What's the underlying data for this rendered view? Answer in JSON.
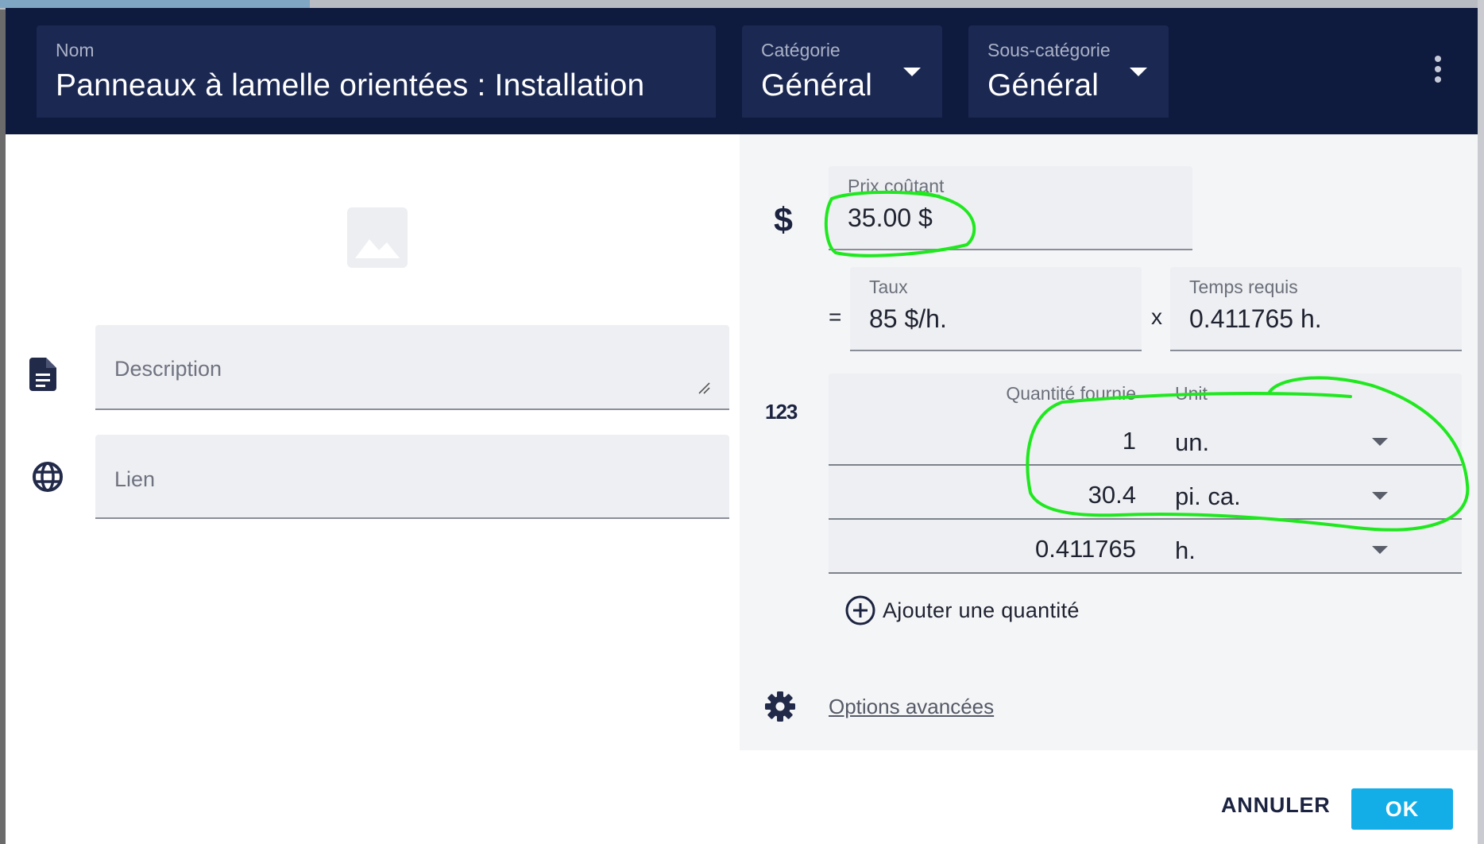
{
  "header": {
    "name_label": "Nom",
    "name_value": "Panneaux à lamelle orientées : Installation",
    "category_label": "Catégorie",
    "category_value": "Général",
    "subcategory_label": "Sous-catégorie",
    "subcategory_value": "Général"
  },
  "left": {
    "description_placeholder": "Description",
    "link_placeholder": "Lien"
  },
  "pricing": {
    "cost_label": "Prix coûtant",
    "cost_value": "35.00 $",
    "equals": "=",
    "rate_label": "Taux",
    "rate_value": "85 $/h.",
    "times": "x",
    "time_label": "Temps requis",
    "time_value": "0.411765 h."
  },
  "quantities": {
    "icon_text": "123",
    "header_qty": "Quantité fournie",
    "header_unit": "Unit",
    "rows": [
      {
        "qty": "1",
        "unit": "un."
      },
      {
        "qty": "30.4",
        "unit": "pi. ca."
      },
      {
        "qty": "0.411765",
        "unit": "h."
      }
    ],
    "add_label": "Ajouter une quantité"
  },
  "advanced_label": "Options avancées",
  "actions": {
    "cancel": "ANNULER",
    "ok": "OK"
  },
  "colors": {
    "header_bg": "#0f1a3f",
    "field_dark": "#1b2852",
    "ok_button": "#13aee8",
    "annotation": "#1fe81f"
  }
}
